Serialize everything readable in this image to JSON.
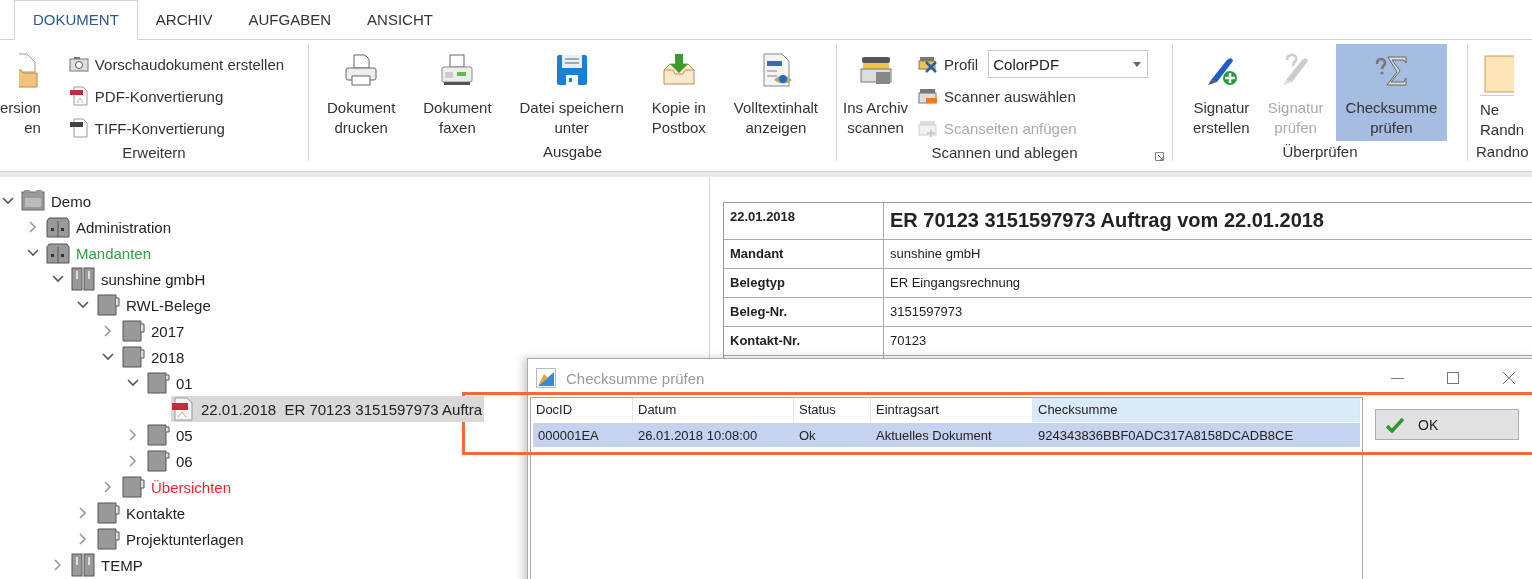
{
  "tabs": [
    {
      "label": "DOKUMENT",
      "selected": true
    },
    {
      "label": "ARCHIV",
      "selected": false
    },
    {
      "label": "AUFGABEN",
      "selected": false
    },
    {
      "label": "ANSICHT",
      "selected": false
    }
  ],
  "ribbon_groups": [
    {
      "label": "Erweitern",
      "launcher": false,
      "items": [
        {
          "kind": "clipped",
          "label": "ersion\nen"
        },
        {
          "kind": "stack",
          "items": [
            {
              "kind": "small",
              "label": "Vorschaudokument erstellen",
              "disabled": false
            },
            {
              "kind": "small",
              "label": "PDF-Konvertierung",
              "disabled": false
            },
            {
              "kind": "small",
              "label": "TIFF-Konvertierung",
              "disabled": false
            }
          ]
        }
      ]
    },
    {
      "label": "Ausgabe",
      "launcher": false,
      "items": [
        {
          "kind": "large",
          "label": "Dokument\ndrucken",
          "selected": false,
          "disabled": false
        },
        {
          "kind": "large",
          "label": "Dokument\nfaxen",
          "selected": false,
          "disabled": false
        },
        {
          "kind": "large",
          "label": "Datei speichern\nunter",
          "selected": false,
          "disabled": false
        },
        {
          "kind": "large",
          "label": "Kopie in\nPostbox",
          "selected": false,
          "disabled": false
        },
        {
          "kind": "large",
          "label": "Volltextinhalt\nanzeigen",
          "selected": false,
          "disabled": false
        }
      ]
    },
    {
      "label": "Scannen und ablegen",
      "launcher": true,
      "items": [
        {
          "kind": "large",
          "label": "Ins Archiv\nscannen",
          "selected": false,
          "disabled": false
        },
        {
          "kind": "stack",
          "items": [
            {
              "kind": "combo",
              "label": "Profil",
              "value": "ColorPDF"
            },
            {
              "kind": "small",
              "label": "Scanner auswählen",
              "disabled": false
            },
            {
              "kind": "small",
              "label": "Scanseiten anfügen",
              "disabled": true
            }
          ]
        }
      ]
    },
    {
      "label": "Überprüfen",
      "launcher": false,
      "items": [
        {
          "kind": "large",
          "label": "Signatur\nerstellen",
          "selected": false,
          "disabled": false
        },
        {
          "kind": "large",
          "label": "Signatur\nprüfen",
          "selected": false,
          "disabled": true
        },
        {
          "kind": "large",
          "label": "Checksumme\nprüfen",
          "selected": true,
          "disabled": false
        }
      ]
    },
    {
      "label": "Randno",
      "launcher": false,
      "items": [
        {
          "kind": "clipped-split",
          "label": "Ne\nRandn"
        }
      ]
    }
  ],
  "tree": [
    {
      "label": "Demo",
      "kind": "repository",
      "expanded": true,
      "selected": false,
      "children": [
        {
          "label": "Administration",
          "kind": "cabinet",
          "expanded": false,
          "selected": false
        },
        {
          "label": "Mandanten",
          "kind": "cabinet",
          "expanded": true,
          "selected": false,
          "color": "#2e9e3e",
          "children": [
            {
              "label": "sunshine gmbH",
              "kind": "binder",
              "expanded": true,
              "selected": false,
              "children": [
                {
                  "label": "RWL-Belege",
                  "kind": "register",
                  "expanded": true,
                  "selected": false,
                  "children": [
                    {
                      "label": "2017",
                      "kind": "register",
                      "expanded": false,
                      "selected": false
                    },
                    {
                      "label": "2018",
                      "kind": "register",
                      "expanded": true,
                      "selected": false,
                      "children": [
                        {
                          "label": "01",
                          "kind": "folder",
                          "expanded": true,
                          "selected": false,
                          "children": [
                            {
                              "label": "22.01.2018  ER 70123 3151597973 Auftra",
                              "kind": "document",
                              "selected": true
                            }
                          ]
                        },
                        {
                          "label": "05",
                          "kind": "folder",
                          "expanded": false,
                          "selected": false
                        },
                        {
                          "label": "06",
                          "kind": "folder",
                          "expanded": false,
                          "selected": false
                        }
                      ]
                    },
                    {
                      "label": "Übersichten",
                      "kind": "register",
                      "expanded": false,
                      "selected": false,
                      "color": "#f5222d"
                    }
                  ]
                },
                {
                  "label": "Kontakte",
                  "kind": "register",
                  "expanded": false,
                  "selected": false
                },
                {
                  "label": "Projektunterlagen",
                  "kind": "register",
                  "expanded": false,
                  "selected": false
                }
              ]
            },
            {
              "label": "TEMP",
              "kind": "binder",
              "expanded": false,
              "selected": false
            }
          ]
        }
      ]
    }
  ],
  "preview": {
    "date": "22.01.2018",
    "title": "ER 70123 3151597973 Auftrag vom 22.01.2018",
    "fields": [
      {
        "label": "Mandant",
        "value": "sunshine gmbH"
      },
      {
        "label": "Belegtyp",
        "value": "ER Eingangsrechnung"
      },
      {
        "label": "Beleg-Nr.",
        "value": "3151597973"
      },
      {
        "label": "Kontakt-Nr.",
        "value": "70123"
      }
    ]
  },
  "dialog": {
    "title": "Checksumme prüfen",
    "columns": [
      {
        "label": "DocID",
        "selected": false
      },
      {
        "label": "Datum",
        "selected": false
      },
      {
        "label": "Status",
        "selected": false
      },
      {
        "label": "Eintragsart",
        "selected": false
      },
      {
        "label": "Checksumme",
        "selected": true
      }
    ],
    "rows": [
      {
        "cells": [
          "000001EA",
          "26.01.2018 10:08:00",
          "Ok",
          "Aktuelles Dokument",
          "924343836BBF0ADC317A8158DCADB8CE"
        ],
        "selected": true
      }
    ],
    "button": "OK"
  }
}
